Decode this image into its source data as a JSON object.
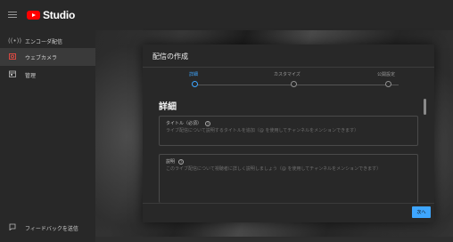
{
  "app": {
    "logo_text": "Studio",
    "brand_color": "#ff0000"
  },
  "sidebar": {
    "items": [
      {
        "label": "エンコーダ配信",
        "icon": "broadcast-icon"
      },
      {
        "label": "ウェブカメラ",
        "icon": "webcam-icon",
        "active": true
      },
      {
        "label": "管理",
        "icon": "calendar-icon"
      }
    ],
    "feedback": {
      "label": "フィードバックを送信",
      "icon": "feedback-icon"
    }
  },
  "dialog": {
    "title": "配信の作成",
    "steps": [
      {
        "label": "詳細",
        "active": true
      },
      {
        "label": "カスタマイズ",
        "active": false
      },
      {
        "label": "公開設定",
        "active": false
      }
    ],
    "section_heading": "詳細",
    "title_field": {
      "label": "タイトル（必須）",
      "placeholder": "ライブ配信について説明するタイトルを追加（@ を使用してチャンネルをメンションできます）"
    },
    "description_field": {
      "label": "説明",
      "placeholder": "このライブ配信について視聴者に詳しく説明しましょう（@ を使用してチャンネルをメンションできます）"
    },
    "next_label": "次へ",
    "accent_color": "#3ea6ff"
  }
}
